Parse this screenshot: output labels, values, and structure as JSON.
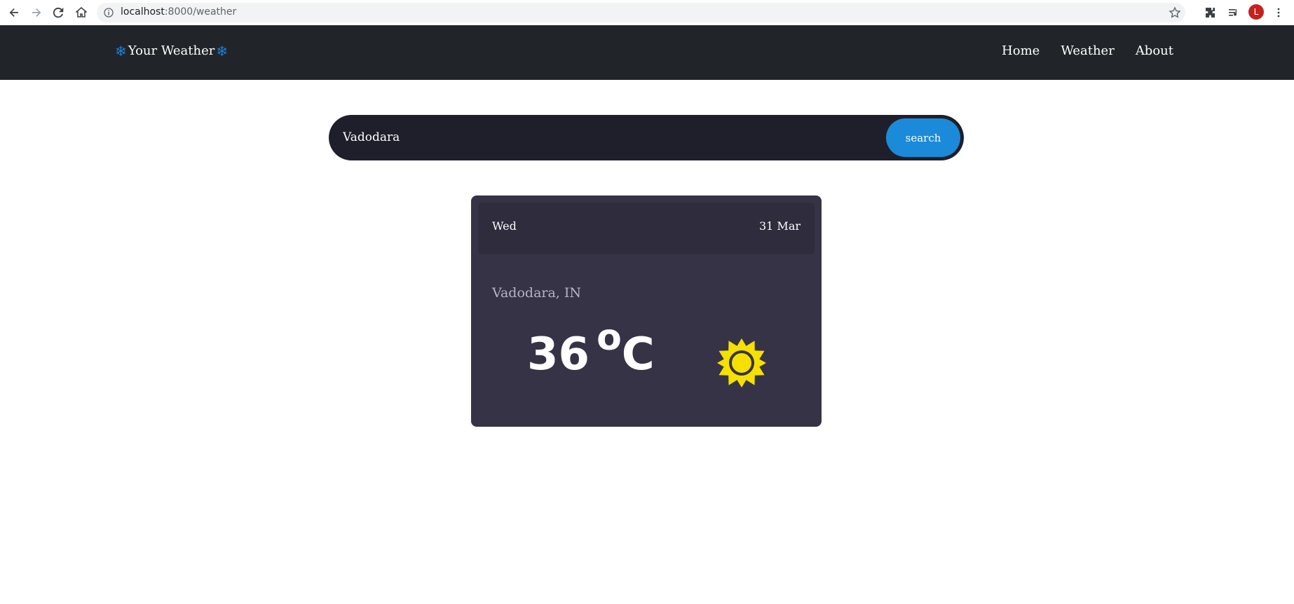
{
  "browser": {
    "url_host": "localhost",
    "url_rest": ":8000/weather",
    "avatar_letter": "L"
  },
  "navbar": {
    "brand_icon": "❄",
    "brand_text": "Your Weather",
    "links": [
      {
        "label": "Home"
      },
      {
        "label": "Weather"
      },
      {
        "label": "About"
      }
    ]
  },
  "search": {
    "value": "Vadodara",
    "button_label": "search"
  },
  "card": {
    "day": "Wed",
    "date": "31 Mar",
    "location": "Vadodara, IN",
    "temperature": "36",
    "degree_symbol": "o",
    "unit": "C",
    "condition_icon": "sun-icon"
  },
  "colors": {
    "navbar_bg": "#212529",
    "brand_icon": "#1b80d6",
    "search_button": "#1b8ad8",
    "card_bg": "#363346",
    "sun": "#f5e000"
  }
}
